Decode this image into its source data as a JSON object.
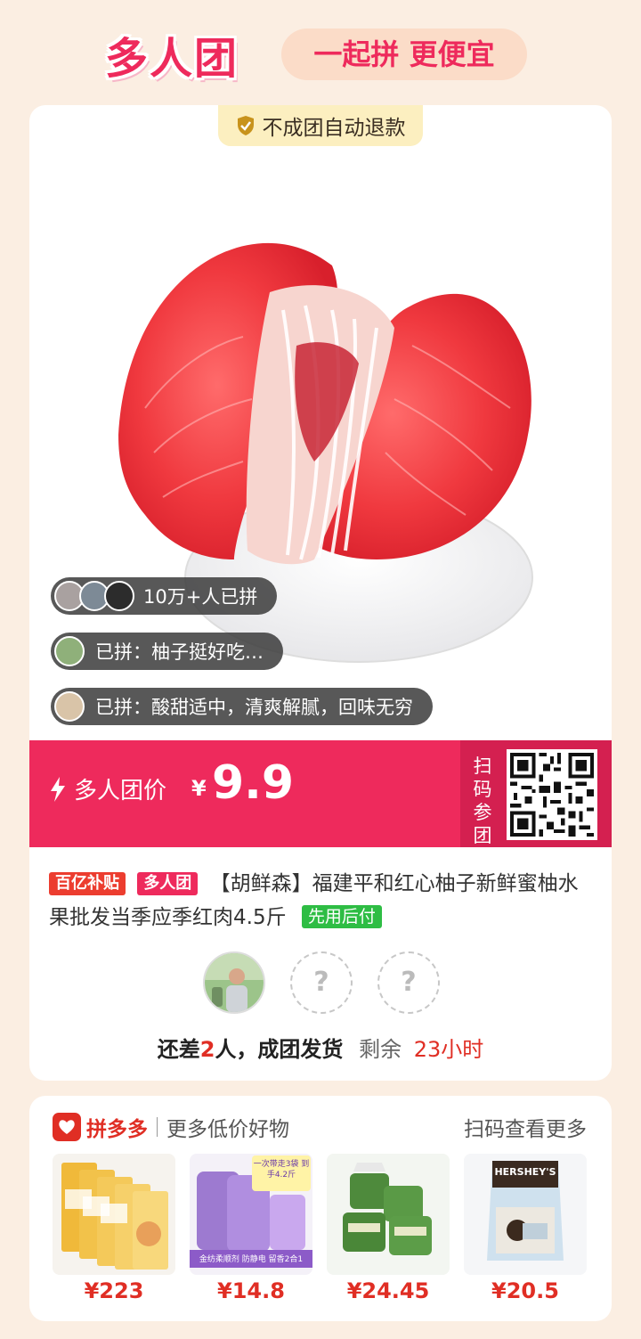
{
  "header": {
    "logo": "多人团",
    "slogan": "一起拼 更便宜"
  },
  "product": {
    "refund_badge": "不成团自动退款",
    "joined_count": "10万+人已拼",
    "reviews": [
      "已拼：柚子挺好吃…",
      "已拼：酸甜适中，清爽解腻，回味无穷"
    ],
    "price_label": "多人团价",
    "currency": "¥",
    "price": "9.9",
    "scan_join": "扫码参团",
    "tag_subsidy": "百亿补贴",
    "tag_group": "多人团",
    "title": "【胡鲜森】福建平和红心柚子新鲜蜜柚水果批发当季应季红肉4.5斤",
    "tag_paylater": "先用后付",
    "status_prefix": "还差",
    "status_count": "2",
    "status_suffix": "人，成团发货",
    "remaining_label": "剩余",
    "remaining_time": "23小时",
    "empty_slot": "?"
  },
  "more": {
    "brand": "拼多多",
    "subtitle": "更多低价好物",
    "scan_more": "扫码查看更多",
    "items": [
      {
        "price": "¥223",
        "icon": "cat-food-bags"
      },
      {
        "price": "¥14.8",
        "icon": "fabric-softener",
        "img_text": "金纺柔顺剂 防静电 留香2合1",
        "banner": "一次带走3袋 到手4.2斤"
      },
      {
        "price": "¥24.45",
        "icon": "cotton-towel-rolls"
      },
      {
        "price": "¥20.5",
        "icon": "hersheys-cookies-bag",
        "brand_text": "HERSHEY'S"
      }
    ]
  },
  "colors": {
    "accent": "#ee2a5c",
    "accent_dark": "#d42050",
    "background": "#fbeee2",
    "price_red": "#e02e24",
    "green": "#2ebd44"
  }
}
